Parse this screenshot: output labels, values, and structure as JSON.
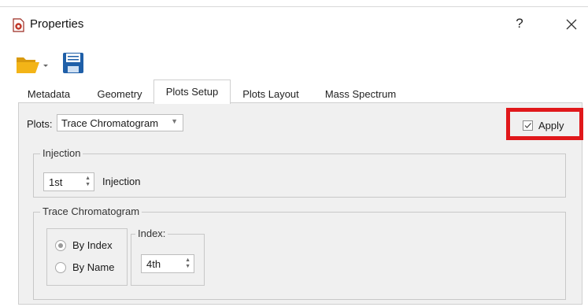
{
  "window": {
    "title": "Properties",
    "help_glyph": "?",
    "close_glyph": "✕"
  },
  "toolbar": {
    "open_icon": "folder-open-icon",
    "save_icon": "floppy-save-icon",
    "dropdown_glyph": "▾"
  },
  "tabs": [
    {
      "label": "Metadata",
      "active": false
    },
    {
      "label": "Geometry",
      "active": false
    },
    {
      "label": "Plots Setup",
      "active": true
    },
    {
      "label": "Plots Layout",
      "active": false
    },
    {
      "label": "Mass Spectrum",
      "active": false
    }
  ],
  "plots": {
    "label": "Plots:",
    "selected": "Trace Chromatogram",
    "apply_label": "Apply",
    "apply_checked": true
  },
  "injection_group": {
    "title": "Injection",
    "value": "1st",
    "label": "Injection"
  },
  "trace_group": {
    "title": "Trace Chromatogram",
    "radio_by_index": "By Index",
    "radio_by_name": "By Name",
    "selected": "By Index",
    "index_title": "Index:",
    "index_value": "4th"
  },
  "colors": {
    "highlight": "#e0181b",
    "panel_bg": "#f0f0f0",
    "folder": "#f3b417",
    "save": "#1f5fa8",
    "app_icon": "#c0392b"
  }
}
